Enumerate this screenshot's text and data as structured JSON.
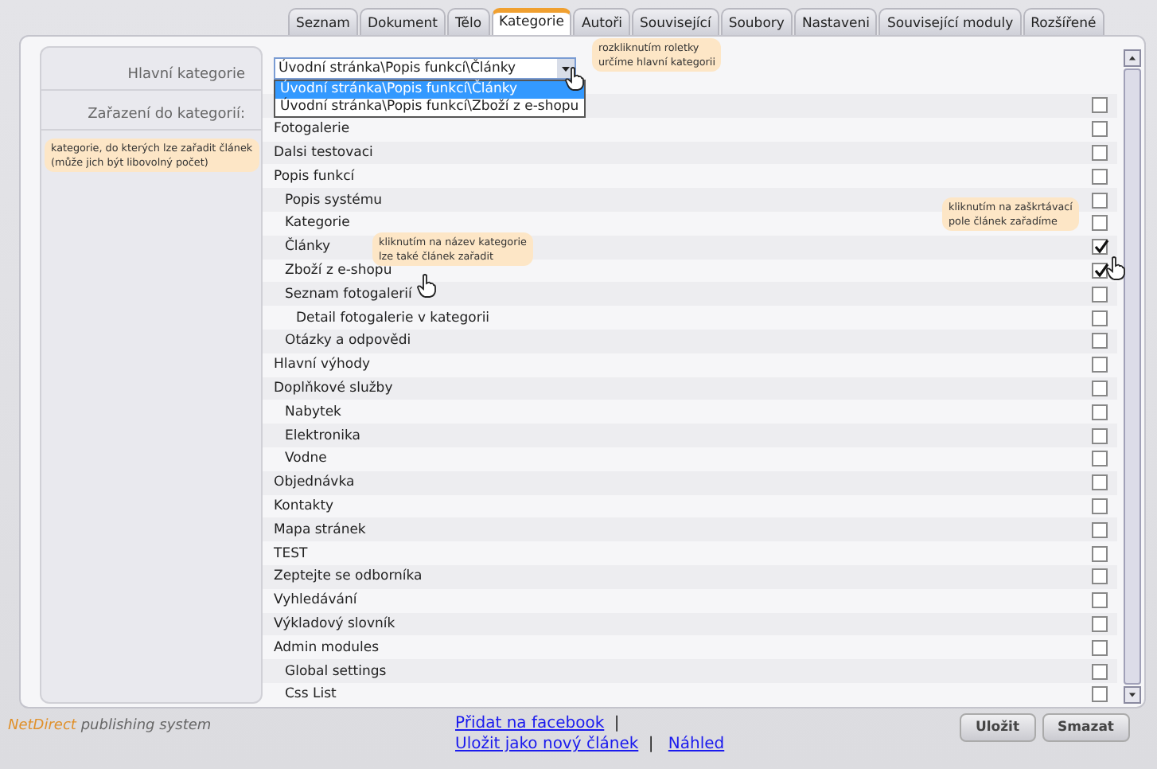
{
  "tabs": [
    {
      "label": "Seznam",
      "selected": false
    },
    {
      "label": "Dokument",
      "selected": false
    },
    {
      "label": "Tělo",
      "selected": false
    },
    {
      "label": "Kategorie",
      "selected": true
    },
    {
      "label": "Autoři",
      "selected": false
    },
    {
      "label": "Související",
      "selected": false
    },
    {
      "label": "Soubory",
      "selected": false
    },
    {
      "label": "Nastaveni",
      "selected": false
    },
    {
      "label": "Související moduly",
      "selected": false
    },
    {
      "label": "Rozšířené",
      "selected": false
    }
  ],
  "form": {
    "main_category_label": "Hlavní kategorie",
    "categories_label": "Zařazení do kategorií:",
    "main_category": {
      "value": "Úvodní stránka\\Popis funkcí\\Články",
      "expanded": true,
      "options": [
        {
          "label": "Úvodní stránka\\Popis funkcí\\Články",
          "selected": true
        },
        {
          "label": "Úvodní stránka\\Popis funkcí\\Zboží z e-shopu",
          "selected": false
        }
      ]
    }
  },
  "categories": [
    {
      "checked": false
    },
    {
      "label": "Fotogalerie",
      "checked": false
    },
    {
      "label": "Dalsi testovaci",
      "checked": false
    },
    {
      "label": "Popis funkcí",
      "checked": false,
      "children": [
        {
          "label": "Popis systému",
          "checked": false
        },
        {
          "label": "Kategorie",
          "checked": false
        },
        {
          "label": "Články",
          "checked": true
        },
        {
          "label": "Zboží z e-shopu",
          "checked": true
        },
        {
          "label": "Seznam fotogalerií",
          "checked": false,
          "children": [
            {
              "label": "Detail fotogalerie v kategorii",
              "checked": false
            }
          ]
        },
        {
          "label": "Otázky a odpovědi",
          "checked": false
        }
      ]
    },
    {
      "label": "Hlavní výhody",
      "checked": false
    },
    {
      "label": "Doplňkové služby",
      "checked": false,
      "children": [
        {
          "label": "Nabytek",
          "checked": false
        },
        {
          "label": "Elektronika",
          "checked": false
        },
        {
          "label": "Vodne",
          "checked": false
        }
      ]
    },
    {
      "label": "Objednávka",
      "checked": false
    },
    {
      "label": "Kontakty",
      "checked": false
    },
    {
      "label": "Mapa stránek",
      "checked": false
    },
    {
      "label": "TEST",
      "checked": false
    },
    {
      "label": "Zeptejte se odborníka",
      "checked": false
    },
    {
      "label": "Vyhledávání",
      "checked": false
    },
    {
      "label": "Výkladový slovník",
      "checked": false
    },
    {
      "label": "Admin modules",
      "checked": false,
      "children": [
        {
          "label": "Global settings",
          "checked": false
        },
        {
          "label": "Css List",
          "checked": false
        }
      ]
    }
  ],
  "tooltips": [
    {
      "kind": "dropdown",
      "lines": [
        "rozkliknutím roletky",
        "určíme hlavní kategorii"
      ]
    },
    {
      "kind": "sidebar",
      "lines": [
        "kategorie, do kterých lze zařadit článek",
        "(může jich být libovolný počet)"
      ]
    },
    {
      "kind": "label",
      "lines": [
        "kliknutím na název kategorie",
        "lze také článek zařadit"
      ]
    },
    {
      "kind": "checkbox",
      "lines": [
        "kliknutím na zaškrtávací",
        "pole článek zařadíme"
      ]
    }
  ],
  "footer": {
    "logo_brand": "NetDirect",
    "logo_suffix": "publishing system",
    "links": [
      "Přidat na facebook",
      "|",
      "Uložit jako nový článek",
      "|",
      "Náhled"
    ],
    "buttons": [
      "Uložit",
      "Smazat"
    ]
  }
}
